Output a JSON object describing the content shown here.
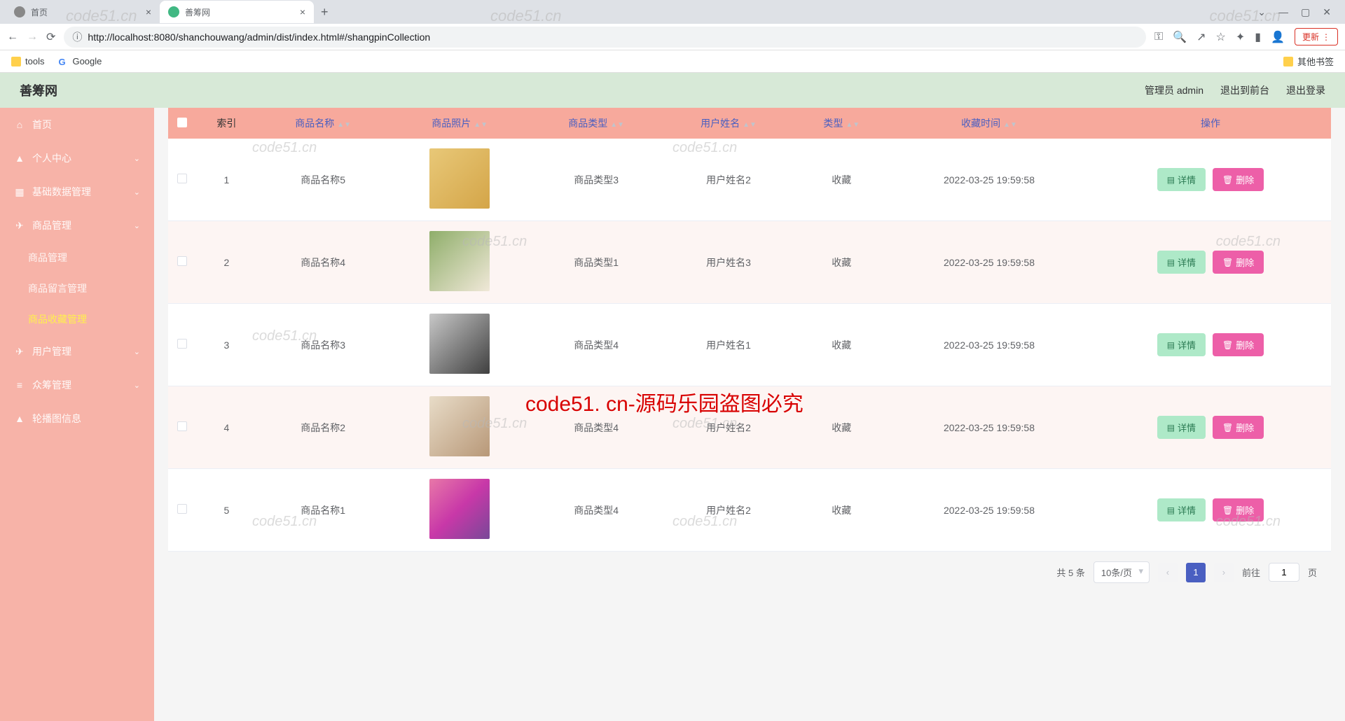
{
  "browser": {
    "tabs": [
      {
        "title": "首页",
        "active": false
      },
      {
        "title": "善筹网",
        "active": true
      }
    ],
    "url": "http://localhost:8080/shanchouwang/admin/dist/index.html#/shangpinCollection",
    "update_button": "更新",
    "bookmarks": [
      {
        "label": "tools",
        "type": "folder"
      },
      {
        "label": "Google",
        "type": "g"
      }
    ],
    "other_bookmarks": "其他书签"
  },
  "header": {
    "title": "善筹网",
    "admin_label": "管理员 admin",
    "exit_front": "退出到前台",
    "logout": "退出登录"
  },
  "sidebar": {
    "home": "首页",
    "personal": "个人中心",
    "basedata": "基础数据管理",
    "product_mgmt": "商品管理",
    "product_sub1": "商品管理",
    "product_sub2": "商品留言管理",
    "product_sub3": "商品收藏管理",
    "user_mgmt": "用户管理",
    "crowd_mgmt": "众筹管理",
    "carousel": "轮播图信息"
  },
  "table": {
    "headers": {
      "index": "索引",
      "product_name": "商品名称",
      "product_photo": "商品照片",
      "product_type": "商品类型",
      "user_name": "用户姓名",
      "type": "类型",
      "collect_time": "收藏时间",
      "action": "操作"
    },
    "rows": [
      {
        "idx": "1",
        "name": "商品名称5",
        "ptype": "商品类型3",
        "user": "用户姓名2",
        "type": "收藏",
        "time": "2022-03-25 19:59:58"
      },
      {
        "idx": "2",
        "name": "商品名称4",
        "ptype": "商品类型1",
        "user": "用户姓名3",
        "type": "收藏",
        "time": "2022-03-25 19:59:58"
      },
      {
        "idx": "3",
        "name": "商品名称3",
        "ptype": "商品类型4",
        "user": "用户姓名1",
        "type": "收藏",
        "time": "2022-03-25 19:59:58"
      },
      {
        "idx": "4",
        "name": "商品名称2",
        "ptype": "商品类型4",
        "user": "用户姓名2",
        "type": "收藏",
        "time": "2022-03-25 19:59:58"
      },
      {
        "idx": "5",
        "name": "商品名称1",
        "ptype": "商品类型4",
        "user": "用户姓名2",
        "type": "收藏",
        "time": "2022-03-25 19:59:58"
      }
    ],
    "detail_btn": "详情",
    "delete_btn": "删除"
  },
  "pagination": {
    "total_label": "共 5 条",
    "page_size": "10条/页",
    "current": "1",
    "goto_prefix": "前往",
    "goto_suffix": "页",
    "goto_value": "1"
  },
  "watermark": "code51.cn",
  "red_text": "code51. cn-源码乐园盗图必究"
}
